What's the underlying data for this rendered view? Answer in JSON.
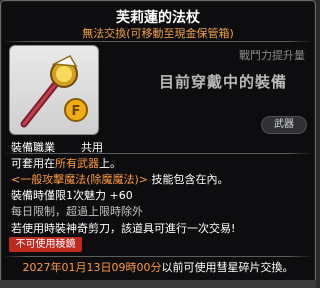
{
  "item": {
    "name": "芙莉蓮的法杖",
    "tradeability": "無法交換(可移動至現金保管箱)",
    "combat_power_label": "戰鬥力提升量",
    "compare_text": "目前穿戴中的裝備",
    "job_label": "裝備職業",
    "job_value": "共用",
    "category": "武器"
  },
  "description": {
    "line1_prefix": "可套用在",
    "line1_highlight": "所有武器",
    "line1_suffix": "上。",
    "line2_highlight": "<一般攻擊魔法(除魔魔法)>",
    "line2_suffix": "技能包含在內。",
    "line3": "裝備時僅限1次魅力 +60",
    "line4": "每日限制，超過上限時除外",
    "line5": "若使用時裝神奇剪刀，該道具可進行一次交易!",
    "warning": "不可使用稜鏡"
  },
  "footer": {
    "expiry": "2027年01月13日09時00分",
    "suffix": "以前可使用彗星碎片交換。"
  },
  "colors": {
    "accent_orange": "#ff9a35",
    "title_orange": "#f3a43a",
    "warning_red": "#be2b1e"
  },
  "icons": {
    "item_icon": "staff-icon"
  }
}
